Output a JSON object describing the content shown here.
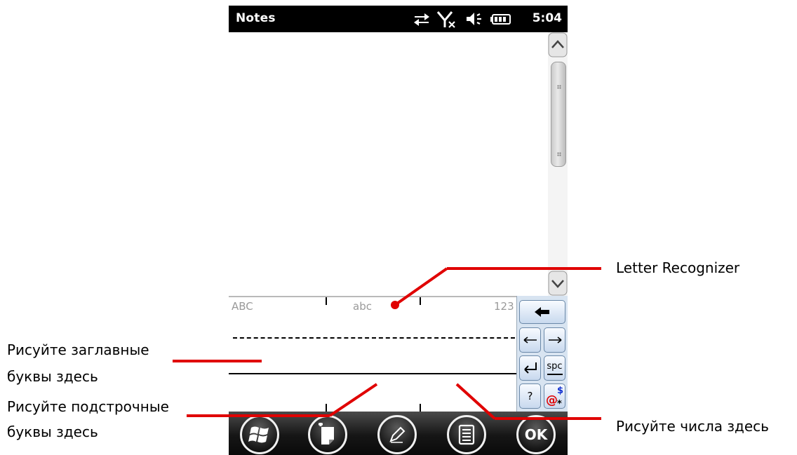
{
  "status_bar": {
    "title": "Notes",
    "time": "5:04",
    "icons": [
      "sync-arrows-icon",
      "no-signal-icon",
      "volume-icon",
      "battery-icon"
    ]
  },
  "recognizer": {
    "labels": {
      "upper": "ABC",
      "lower": "abc",
      "numbers": "123"
    }
  },
  "keypad": {
    "keys": [
      "backspace",
      "left",
      "right",
      "enter",
      "spc",
      "?",
      "symbols"
    ],
    "space_label": "spc",
    "help_label": "?"
  },
  "bottom_bar": {
    "buttons": [
      "start-icon",
      "new-note-icon",
      "pen-icon",
      "menu-icon",
      "ok"
    ],
    "ok_label": "OK"
  },
  "annotations": {
    "letter_recognizer": "Letter Recognizer",
    "uppercase_line1": "Рисуйте заглавные",
    "uppercase_line2": "буквы здесь",
    "lowercase_line1": "Рисуйте подстрочные",
    "lowercase_line2": "буквы здесь",
    "numbers": "Рисуйте числа здесь"
  },
  "colors": {
    "annotation": "#e00000",
    "keypad_bg": "#d8e4f1",
    "status_bar": "#000000"
  }
}
